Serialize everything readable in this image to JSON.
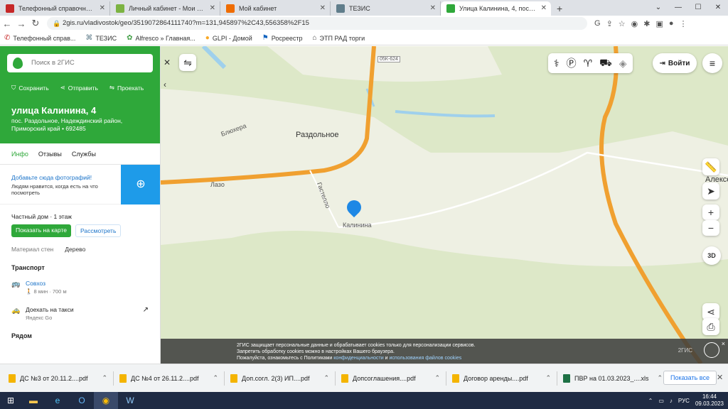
{
  "browser": {
    "tabs": [
      {
        "title": "Телефонный справочник АО Са...",
        "icon": "phone-icon",
        "color": "#c62828",
        "active": false
      },
      {
        "title": "Личный кабинет - Мои объявл...",
        "icon": "avito-icon",
        "color": "#7cb342",
        "active": false
      },
      {
        "title": "Мой кабинет",
        "icon": "orange-f-icon",
        "color": "#ef6c00",
        "active": false
      },
      {
        "title": "ТЕЗИС",
        "icon": "tezis-icon",
        "color": "#607d8b",
        "active": false
      },
      {
        "title": "Улица Калинина, 4, пос. Раздол...",
        "icon": "2gis-icon",
        "color": "#2fa83a",
        "active": true
      }
    ],
    "new_tab": "+",
    "url": "2gis.ru/vladivostok/geo/3519072864111740?m=131,945897%2C43,556358%2F15",
    "bookmarks": [
      {
        "label": "Телефонный справ...",
        "icon": "phone-icon"
      },
      {
        "label": "ТЕЗИС",
        "icon": "tezis-icon"
      },
      {
        "label": "Alfresco » Главная...",
        "icon": "alfresco-icon"
      },
      {
        "label": "GLPI - Домой",
        "icon": "glpi-icon"
      },
      {
        "label": "Росреестр",
        "icon": "rosreestr-icon"
      },
      {
        "label": "ЭТП РАД торги",
        "icon": "etp-icon"
      }
    ]
  },
  "sidebar": {
    "search_placeholder": "Поиск в 2ГИС",
    "actions": {
      "save": "Сохранить",
      "share": "Отправить",
      "route": "Проехать"
    },
    "title": "улица Калинина, 4",
    "address": "пос. Раздольное, Надеждинский район, Приморский край • 692485",
    "tabs": [
      "Инфо",
      "Отзывы",
      "Службы"
    ],
    "photo_prompt": "Добавьте сюда фотографий!",
    "photo_hint": "Людям нравится, когда есть на что посмотреть",
    "house_type": "Частный дом · 1 этаж",
    "show_on_map": "Показать на карте",
    "view": "Рассмотреть",
    "material_label": "Материал стен",
    "material_value": "Дерево",
    "transport_title": "Транспорт",
    "stop_name": "Совхоз",
    "stop_info": "8 мин · 700 м",
    "taxi_label": "Доехать на такси",
    "taxi_provider": "Яндекс Go",
    "nearby_title": "Рядом"
  },
  "map": {
    "labels": {
      "town": "Раздольное",
      "street_kalinina": "Калинина",
      "street_lazo": "Лазо",
      "street_gastello": "Гастелло",
      "street_blyukhera": "Блюхера",
      "road_code": "05К-624",
      "neighbor_town": "Алексе"
    },
    "login": "Войти",
    "zoom_in": "+",
    "zoom_out": "−",
    "view_3d": "3D",
    "colors": {
      "forest": "#dde8c8",
      "meadow": "#eef0e3",
      "road": "#f0a030",
      "water": "#9fd0ec",
      "pin": "#1e88e5"
    }
  },
  "cookie": {
    "line1": "2ГИС защищает персональные данные и обрабатывает cookies только для персонализации сервисов.",
    "line2": "Запретить обработку cookies можно в настройках Вашего браузера.",
    "line3_prefix": "Пожалуйста, ознакомьтесь с Политиками",
    "link1": "конфиденциальности",
    "and": "и",
    "link2": "использования файлов cookies",
    "logo": "2ГИС",
    "close": "×"
  },
  "downloads": {
    "items": [
      {
        "name": "ДС №3 от 20.11.2....pdf",
        "type": "pdf"
      },
      {
        "name": "ДС №4 от 26.11.2....pdf",
        "type": "pdf"
      },
      {
        "name": "Доп.согл. 2(3) ИП....pdf",
        "type": "pdf"
      },
      {
        "name": "Допсоглашения....pdf",
        "type": "pdf"
      },
      {
        "name": "Договор аренды....pdf",
        "type": "pdf"
      },
      {
        "name": "ПВР на 01.03.2023_....xls",
        "type": "xls"
      }
    ],
    "show_all": "Показать все"
  },
  "taskbar": {
    "lang": "РУС",
    "time": "16:44",
    "date": "09.03.2023"
  }
}
